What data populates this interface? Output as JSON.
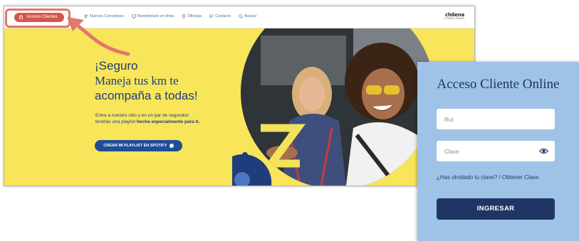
{
  "navbar": {
    "acceso_label": "Acceso Clientes",
    "items": [
      {
        "label": "Nuevos Corredores",
        "icon": "users-icon"
      },
      {
        "label": "Reembolsos en línea",
        "icon": "monitor-icon"
      },
      {
        "label": "Oficinas",
        "icon": "pin-icon"
      },
      {
        "label": "Contacto",
        "icon": "chat-icon"
      },
      {
        "label": "Buscar",
        "icon": "search-icon"
      }
    ],
    "brand": "chilena",
    "brand_sub": "CONSOLIDADA"
  },
  "hero": {
    "title_line1": "¡Seguro",
    "title_line2": "Maneja tus km te",
    "title_line3": "acompaña a todas!",
    "text_main": "Entra a nuestro sitio y en un par de segundos tendrás una playlist",
    "text_bold1": "hecha",
    "text_bold2": "especialmente para ti.",
    "cta_label": "CREAR MI PLAYLIST EN SPOTIFY"
  },
  "login": {
    "title": "Acceso Cliente Online",
    "rut_placeholder": "Rut",
    "clave_placeholder": "Clave",
    "forgot": "¿Has olvidado tu clave? / Obtener Clave",
    "submit": "INGRESAR"
  },
  "colors": {
    "hero_yellow": "#f8e55a",
    "brand_blue": "#1f3d7a",
    "accent_red": "#d2574b",
    "login_bg": "#9fc3e6",
    "button_navy": "#1f3566"
  }
}
